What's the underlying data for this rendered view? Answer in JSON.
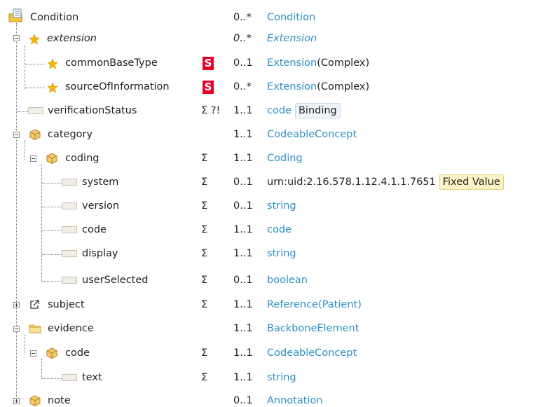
{
  "tree": {
    "rows": [
      {
        "name": "Condition",
        "card": "0..*",
        "type": "Condition"
      },
      {
        "name": "extension",
        "card": "0..*",
        "type": "Extension"
      },
      {
        "name": "commonBaseType",
        "s": "S",
        "card": "0..1",
        "type": "Extension",
        "type_suffix": "(Complex)"
      },
      {
        "name": "sourceOfInformation",
        "s": "S",
        "card": "0..*",
        "type": "Extension",
        "type_suffix": "(Complex)"
      },
      {
        "name": "verificationStatus",
        "flags": "Σ ?!",
        "card": "1..1",
        "type": "code",
        "badge": "Binding"
      },
      {
        "name": "category",
        "card": "1..1",
        "type": "CodeableConcept"
      },
      {
        "name": "coding",
        "flags": "Σ",
        "card": "1..1",
        "type": "Coding"
      },
      {
        "name": "system",
        "flags": "Σ",
        "card": "0..1",
        "type": "urn:uid:2.16.578.1.12.4.1.1.7651",
        "badge": "Fixed Value"
      },
      {
        "name": "version",
        "flags": "Σ",
        "card": "0..1",
        "type": "string"
      },
      {
        "name": "code",
        "flags": "Σ",
        "card": "1..1",
        "type": "code"
      },
      {
        "name": "display",
        "flags": "Σ",
        "card": "1..1",
        "type": "string"
      },
      {
        "name": "userSelected",
        "flags": "Σ",
        "card": "0..1",
        "type": "boolean"
      },
      {
        "name": "subject",
        "flags": "Σ",
        "card": "1..1",
        "type": "Reference",
        "type_suffix_pre": "(",
        "type_suffix_link": "Patient",
        "type_suffix_post": ")"
      },
      {
        "name": "evidence",
        "card": "1..1",
        "type": "BackboneElement"
      },
      {
        "name": "code",
        "flags": "Σ",
        "card": "1..1",
        "type": "CodeableConcept"
      },
      {
        "name": "text",
        "flags": "Σ",
        "card": "1..1",
        "type": "string"
      },
      {
        "name": "note",
        "card": "0..1",
        "type": "Annotation"
      }
    ]
  },
  "colors": {
    "link": "#2e8ec7",
    "must_support": "#e8002a",
    "guide": "#777777"
  },
  "icons": {
    "root": "resource-icon",
    "extension": "extension-star-icon",
    "primitive": "primitive-element-icon",
    "complex": "datatype-cube-icon",
    "reference": "reference-link-icon",
    "backbone": "folder-icon"
  }
}
